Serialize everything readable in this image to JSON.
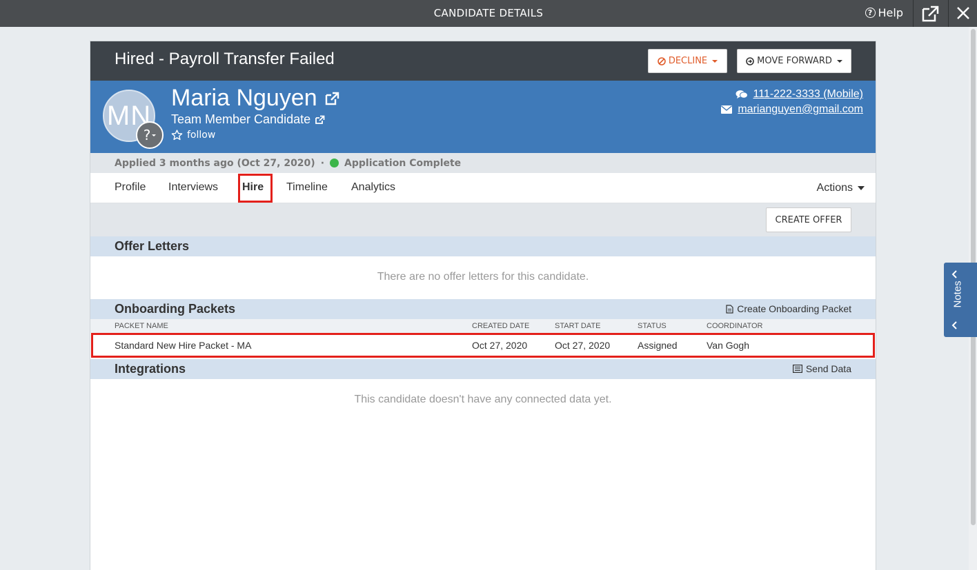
{
  "window": {
    "title": "CANDIDATE DETAILS",
    "help_label": "Help"
  },
  "candidate": {
    "status_title": "Hired - Payroll Transfer Failed",
    "decline_label": "DECLINE",
    "move_forward_label": "MOVE FORWARD",
    "initials": "MN",
    "avatar_badge": "?",
    "name": "Maria Nguyen",
    "role": "Team Member Candidate",
    "follow_label": "follow",
    "phone": "111-222-3333 (Mobile)",
    "email": "marianguyen@gmail.com",
    "applied_text": "Applied 3 months ago (Oct 27, 2020)",
    "separator": "·",
    "application_status": "Application Complete"
  },
  "tabs": [
    {
      "label": "Profile"
    },
    {
      "label": "Interviews"
    },
    {
      "label": "Hire",
      "active": true
    },
    {
      "label": "Timeline"
    },
    {
      "label": "Analytics"
    }
  ],
  "actions_label": "Actions",
  "hire": {
    "create_offer_label": "CREATE OFFER",
    "offer_letters": {
      "title": "Offer Letters",
      "empty": "There are no offer letters for this candidate."
    },
    "onboarding": {
      "title": "Onboarding Packets",
      "action_label": "Create Onboarding Packet",
      "columns": [
        "PACKET NAME",
        "CREATED DATE",
        "START DATE",
        "STATUS",
        "COORDINATOR"
      ],
      "rows": [
        {
          "name": "Standard New Hire Packet - MA",
          "created": "Oct 27, 2020",
          "start": "Oct 27, 2020",
          "status": "Assigned",
          "coordinator": "Van Gogh"
        }
      ]
    },
    "integrations": {
      "title": "Integrations",
      "action_label": "Send Data",
      "empty": "This candidate doesn't have any connected data yet."
    }
  },
  "notes_label": "Notes",
  "colors": {
    "status_bar": "#3d4349",
    "profile_band": "#3f7ab9",
    "section_head": "#d3e0ee",
    "highlight": "#e3201b",
    "decline": "#e05c2a",
    "complete": "#3cb54a"
  }
}
